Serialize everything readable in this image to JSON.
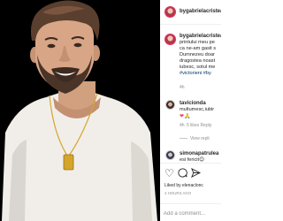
{
  "post": {
    "author": "bygabrielacristea",
    "caption_lines": [
      "printului meu pe",
      "ca ne-am gasit s",
      "Dumnezeu doar",
      "dragostea noast",
      "iubesc, sotul me"
    ],
    "caption_tags": "#victorieni #by",
    "caption_age": "4h"
  },
  "comments": [
    {
      "author": "tavicionda",
      "text": "multumesc,iubir",
      "hearts": "❤🙏",
      "time": "4h",
      "meta": "5 likes  Reply",
      "view_replies": "View repli"
    },
    {
      "author": "simonapatrulea",
      "text": "esi fericit😊",
      "emoji_line": "😊😊😊",
      "time": "4h",
      "meta": "Reply"
    }
  ],
  "actions": {
    "like_icon": "heart-outline-icon",
    "comment_icon": "comment-bubble-icon",
    "share_icon": "paper-plane-icon",
    "liked_by": "Liked by elenaclonc",
    "time_ago": "4 HOURS AGO"
  },
  "add_comment": {
    "placeholder": "Add a comment..."
  },
  "colors": {
    "photo_bg": "#000000",
    "link": "#00376b",
    "muted": "#8e8e8e",
    "like_red": "#ed4956",
    "chain_gold": "#d4a52a"
  }
}
